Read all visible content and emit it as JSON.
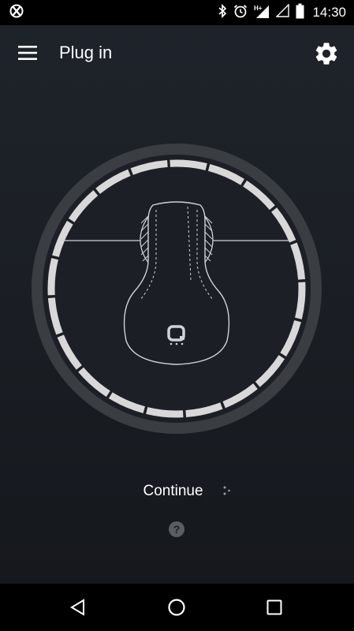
{
  "status_bar": {
    "time": "14:30",
    "icons": [
      "app-notification-icon",
      "bluetooth-icon",
      "alarm-icon",
      "hplus-signal-icon",
      "signal-icon",
      "battery-icon"
    ]
  },
  "toolbar": {
    "title": "Plug in",
    "menu_icon": "hamburger-menu-icon",
    "settings_icon": "gear-icon"
  },
  "main": {
    "continue_label": "Continue",
    "help_label": "?"
  },
  "nav_bar": {
    "icons": [
      "back-icon",
      "home-icon",
      "recents-icon"
    ]
  },
  "colors": {
    "background": "#1b1f25",
    "ring_outer": "#3a3d41",
    "ring_segments": "#d9d9d9",
    "device_outline": "#cfd2d6"
  }
}
